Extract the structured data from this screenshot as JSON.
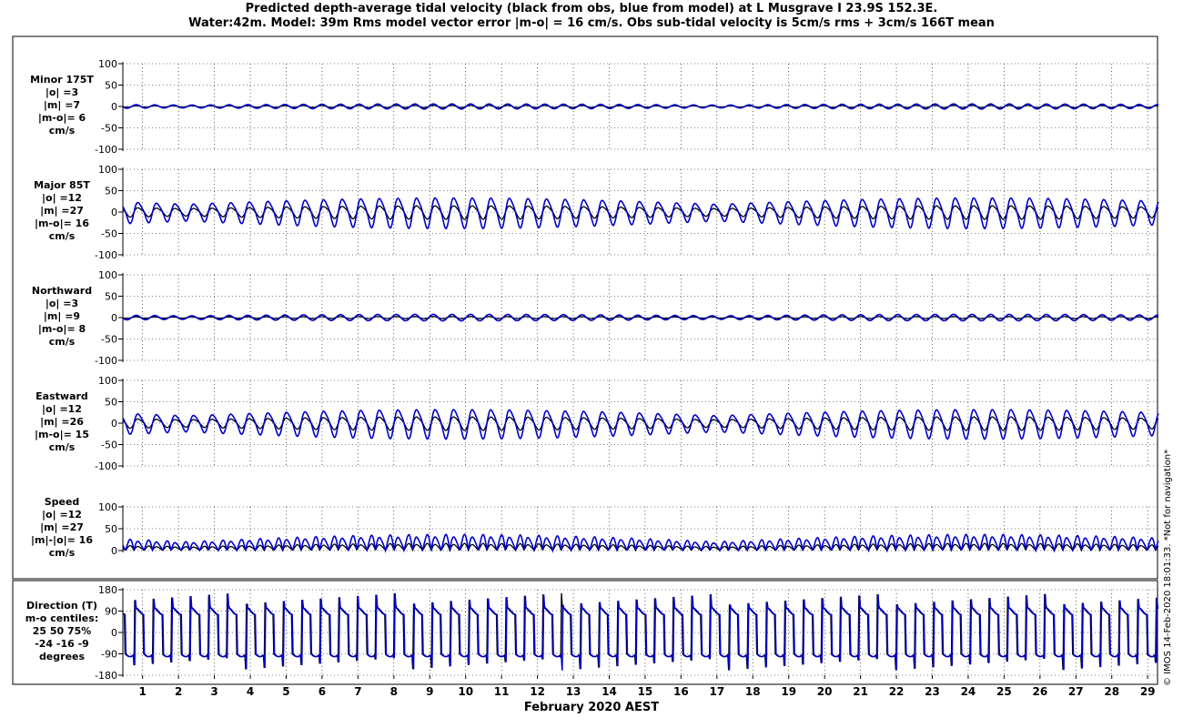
{
  "chart_data": {
    "type": "line",
    "title": "Predicted depth-average tidal velocity (black from obs, blue from model) at L Musgrave I 23.9S 152.3E.",
    "subtitle": "Water:42m. Model: 39m  Rms model vector error |m-o| = 16 cm/s. Obs sub-tidal velocity is 5cm/s rms + 3cm/s 166T mean",
    "xlabel": "February 2020 AEST",
    "x_ticks": [
      "1",
      "2",
      "3",
      "4",
      "5",
      "6",
      "7",
      "8",
      "9",
      "10",
      "11",
      "12",
      "13",
      "14",
      "15",
      "16",
      "17",
      "18",
      "19",
      "20",
      "21",
      "22",
      "23",
      "24",
      "25",
      "26",
      "27",
      "28",
      "29"
    ],
    "xlim": [
      0.45,
      29.3
    ],
    "grid": true,
    "side_note": "© IMOS 14-Feb-2020 18:01:33. *Not for navigation*",
    "colors": {
      "obs": "#000000",
      "model": "#0000cc"
    },
    "panels": [
      {
        "key": "minor",
        "labels": [
          "Minor 175T",
          "|o| =3",
          "|m| =7",
          "|m-o|= 6",
          "cm/s"
        ],
        "ylim": [
          -100,
          100
        ],
        "yticks": [
          "100",
          "50",
          "0",
          "-50",
          "-100"
        ],
        "series": [
          {
            "role": "obs",
            "amplitude": 3,
            "mean": 0
          },
          {
            "role": "model",
            "amplitude": 7,
            "mean": 0
          }
        ]
      },
      {
        "key": "major",
        "labels": [
          "Major 85T",
          "|o| =12",
          "|m| =27",
          "|m-o|= 16",
          "cm/s"
        ],
        "ylim": [
          -100,
          100
        ],
        "yticks": [
          "100",
          "50",
          "0",
          "-50",
          "-100"
        ],
        "series": [
          {
            "role": "obs",
            "amplitude": 12,
            "mean": 0
          },
          {
            "role": "model",
            "amplitude": 27,
            "mean": 0
          }
        ]
      },
      {
        "key": "north",
        "labels": [
          "Northward",
          "|o| =3",
          "|m| =9",
          "|m-o|= 8",
          "cm/s"
        ],
        "ylim": [
          -100,
          100
        ],
        "yticks": [
          "100",
          "50",
          "0",
          "-50",
          "-100"
        ],
        "series": [
          {
            "role": "obs",
            "amplitude": 3,
            "mean": 0
          },
          {
            "role": "model",
            "amplitude": 9,
            "mean": 0
          }
        ]
      },
      {
        "key": "east",
        "labels": [
          "Eastward",
          "|o| =12",
          "|m| =26",
          "|m-o|= 15",
          "cm/s"
        ],
        "ylim": [
          -100,
          100
        ],
        "yticks": [
          "100",
          "50",
          "0",
          "-50",
          "-100"
        ],
        "series": [
          {
            "role": "obs",
            "amplitude": 12,
            "mean": 0
          },
          {
            "role": "model",
            "amplitude": 26,
            "mean": 0
          }
        ]
      },
      {
        "key": "speed",
        "labels": [
          "Speed",
          "|o| =12",
          "|m| =27",
          "|m|-|o|= 16",
          "cm/s"
        ],
        "ylim": [
          0,
          100
        ],
        "yticks": [
          "100",
          "50",
          "0"
        ],
        "series": [
          {
            "role": "obs",
            "amplitude": 12,
            "mean": 0
          },
          {
            "role": "model",
            "amplitude": 27,
            "mean": 0
          }
        ]
      },
      {
        "key": "direction",
        "labels": [
          "Direction (T)",
          "m-o centiles:",
          "25  50  75%",
          "-24 -16  -9",
          "degrees"
        ],
        "ylim": [
          -180,
          180
        ],
        "yticks": [
          "180",
          "90",
          "0",
          "-90",
          "-180"
        ],
        "series": [
          {
            "role": "obs"
          },
          {
            "role": "model"
          }
        ]
      }
    ]
  }
}
